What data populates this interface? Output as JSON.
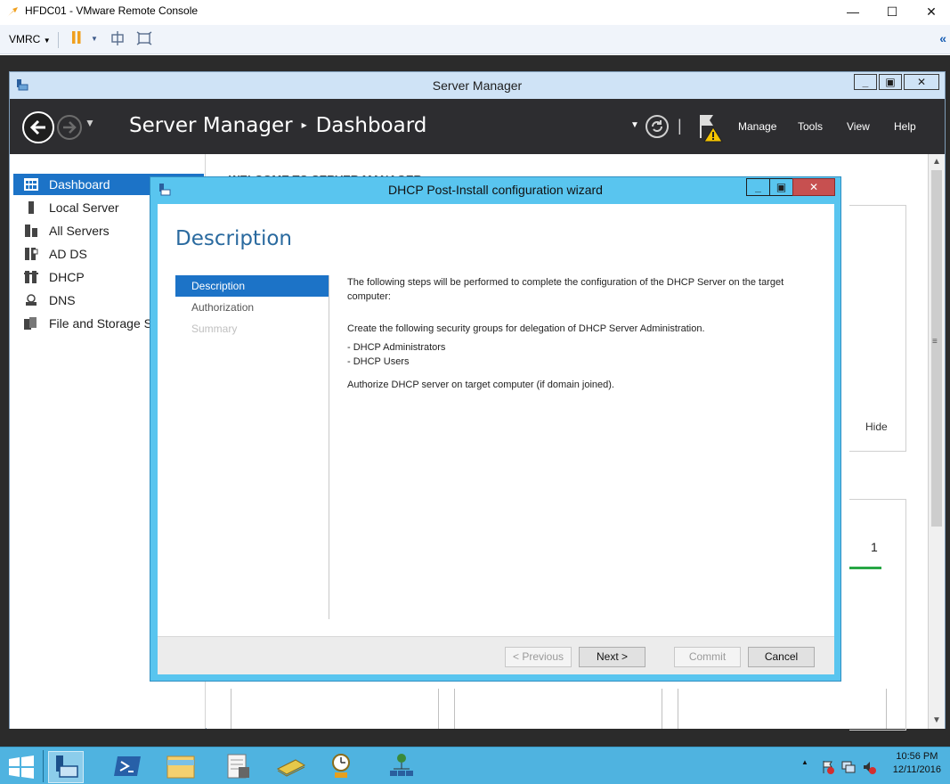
{
  "vmrc": {
    "window_title": "HFDC01 - VMware Remote Console",
    "menu_label": "VMRC",
    "min": "—",
    "max": "☐",
    "close": "✕",
    "collapse": "«"
  },
  "server_manager": {
    "window_title": "Server Manager",
    "breadcrumb_app": "Server Manager",
    "breadcrumb_sep": "▸",
    "breadcrumb_page": "Dashboard",
    "menu": [
      "Manage",
      "Tools",
      "View",
      "Help"
    ],
    "sidebar": [
      {
        "label": "Dashboard",
        "icon": "dashboard-icon",
        "active": true
      },
      {
        "label": "Local Server",
        "icon": "local-server-icon"
      },
      {
        "label": "All Servers",
        "icon": "all-servers-icon"
      },
      {
        "label": "AD DS",
        "icon": "ad-ds-icon"
      },
      {
        "label": "DHCP",
        "icon": "dhcp-icon"
      },
      {
        "label": "DNS",
        "icon": "dns-icon"
      },
      {
        "label": "File and Storage Ser",
        "icon": "file-storage-icon"
      }
    ],
    "welcome": "WELCOME TO SERVER MANAGER",
    "hide_link": "Hide",
    "tile_count": "1"
  },
  "wizard": {
    "title": "DHCP Post-Install configuration wizard",
    "heading": "Description",
    "steps": [
      {
        "label": "Description",
        "state": "active"
      },
      {
        "label": "Authorization",
        "state": "normal"
      },
      {
        "label": "Summary",
        "state": "disabled"
      }
    ],
    "intro": "The following steps will be performed to complete the configuration of the DHCP Server on the target computer:",
    "groups_line": "Create the following security groups for delegation of DHCP Server Administration.",
    "group1": "- DHCP Administrators",
    "group2": "- DHCP Users",
    "authorize": "Authorize DHCP server on target computer (if domain joined).",
    "buttons": {
      "previous": "< Previous",
      "next": "Next >",
      "commit": "Commit",
      "cancel": "Cancel"
    }
  },
  "taskbar": {
    "time": "10:56 PM",
    "date": "12/11/2016",
    "tray_arrow": "▲"
  }
}
